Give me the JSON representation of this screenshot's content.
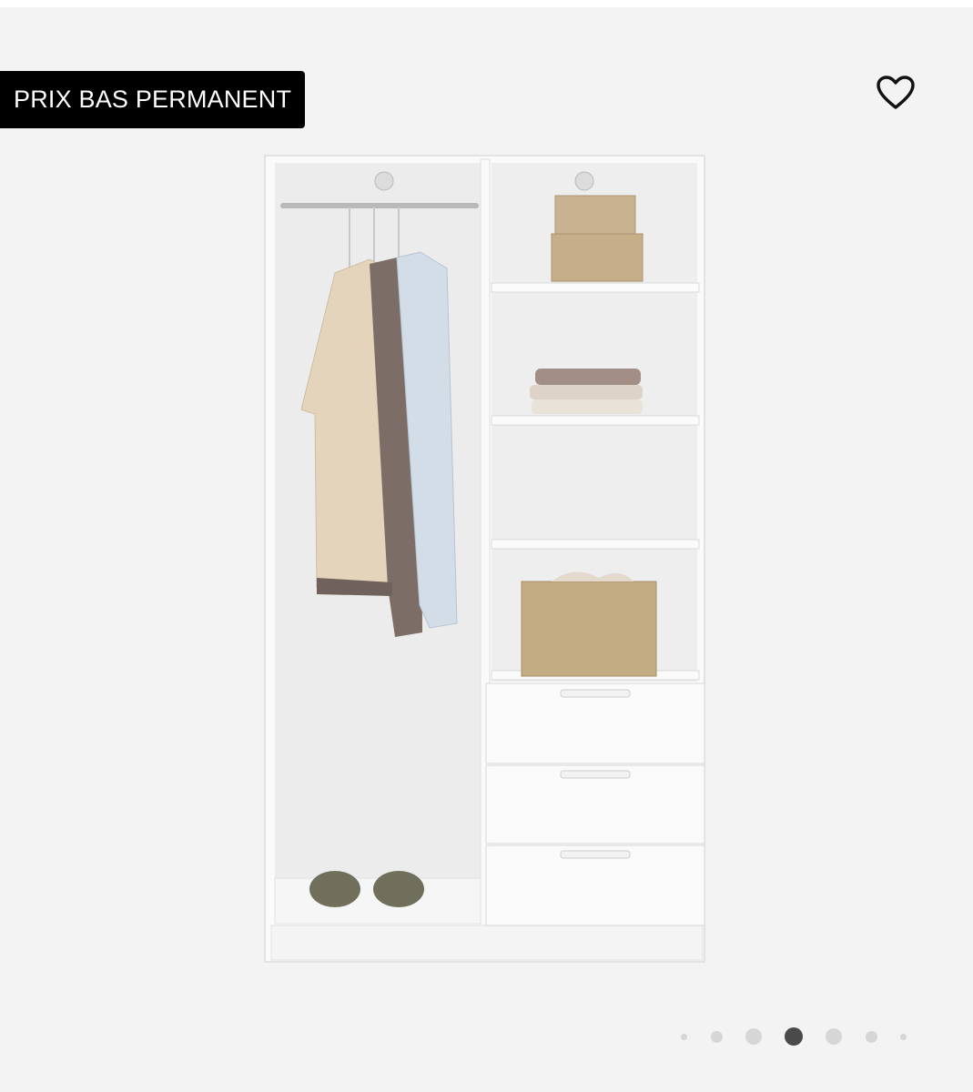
{
  "badge": {
    "label": "PRIX BAS PERMANENT"
  },
  "favorite": {
    "icon": "heart-outline-icon"
  },
  "product_image": {
    "subject": "white open wardrobe with hanging rail, shelves and three drawers"
  },
  "carousel": {
    "total": 7,
    "active_index": 3
  },
  "colors": {
    "background": "#f3f3f3",
    "badge_bg": "#000000",
    "badge_text": "#ffffff",
    "dot_active": "#4a4a4a",
    "dot_inactive": "#d6d6d6"
  }
}
